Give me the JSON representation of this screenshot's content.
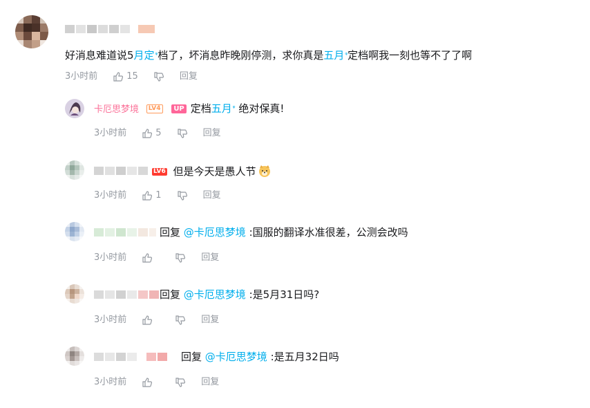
{
  "comment": {
    "text_pre": "好消息难道说5",
    "kw1": "月定",
    "text_mid": "档了，坏消息昨晚刚停测，求你真是",
    "kw2": "五月",
    "text_post": "定档啊我一刻也等不了了啊",
    "time": "3小时前",
    "likes": "15",
    "reply_label": "回复"
  },
  "replies": [
    {
      "user": "卡厄思梦境",
      "level": "LV4",
      "up_badge": "UP",
      "text_pre": "定档",
      "kw": "五月",
      "text_post": " 绝对保真!",
      "time": "3小时前",
      "likes": "5",
      "reply_label": "回复"
    },
    {
      "level": "LV6",
      "text": "但是今天是愚人节",
      "time": "3小时前",
      "likes": "1",
      "reply_label": "回复"
    },
    {
      "reply_prefix": "回复",
      "mention": "@卡厄思梦境",
      "text": ":国服的翻译水准很差，公测会改吗",
      "time": "3小时前",
      "reply_label": "回复"
    },
    {
      "reply_prefix": "回复",
      "mention": "@卡厄思梦境",
      "text": ":是5月31日吗?",
      "time": "3小时前",
      "reply_label": "回复"
    },
    {
      "reply_prefix": "回复",
      "mention": "@卡厄思梦境",
      "text": ":是五月32日吗",
      "time": "3小时前",
      "reply_label": "回复"
    }
  ],
  "colors": {
    "link": "#00aeec",
    "meta": "#9499a0",
    "up": "#ff6699",
    "level_orange": "#ff9a5a",
    "level_red": "#ff3b30"
  }
}
